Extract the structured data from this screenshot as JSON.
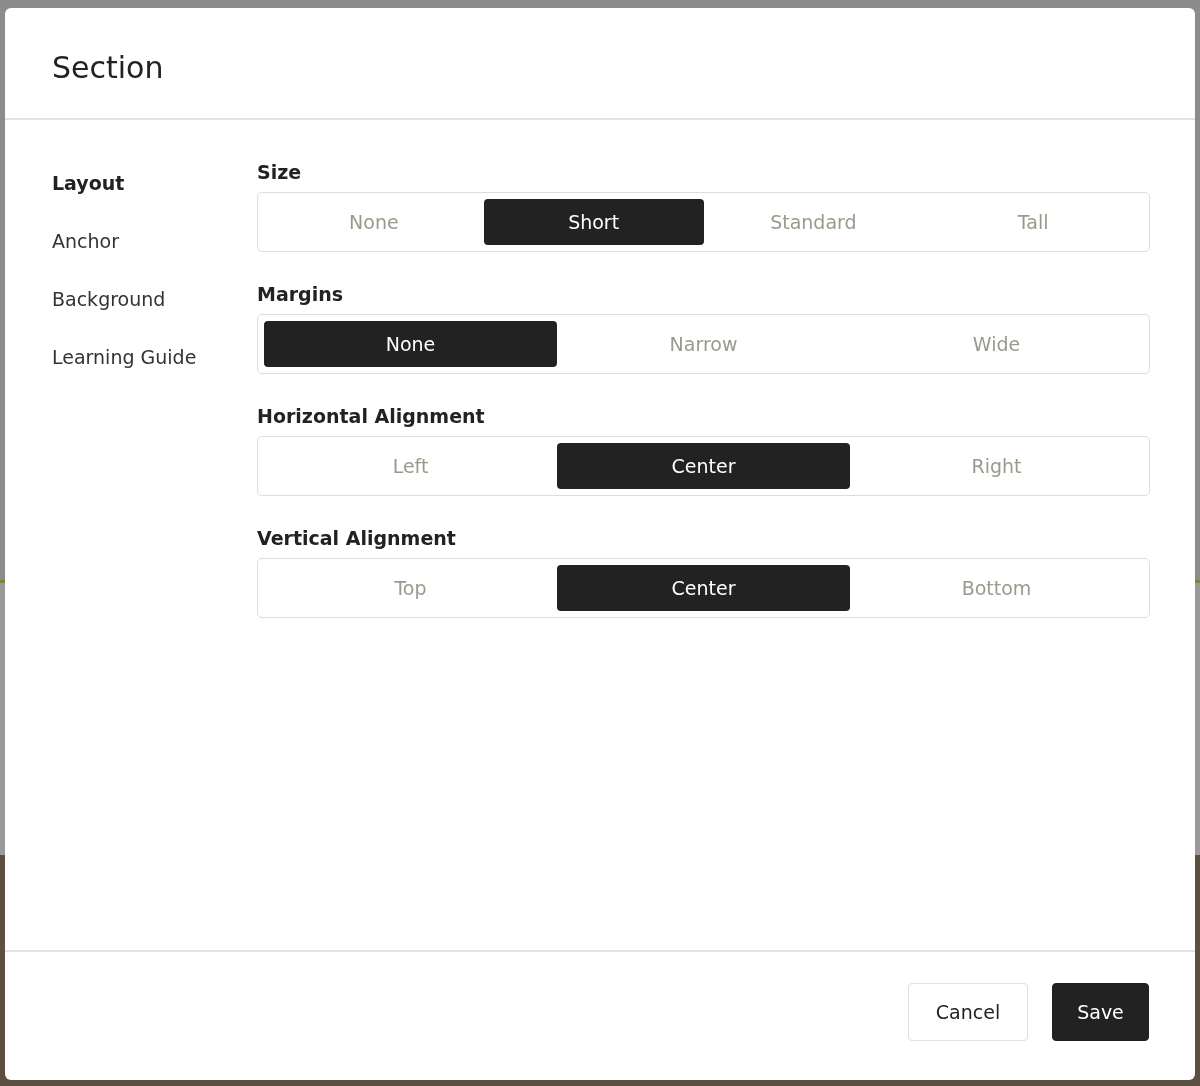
{
  "dialog": {
    "title": "Section",
    "sidebar": {
      "items": [
        {
          "label": "Layout",
          "selected": true
        },
        {
          "label": "Anchor",
          "selected": false
        },
        {
          "label": "Background",
          "selected": false
        },
        {
          "label": "Learning Guide",
          "selected": false
        }
      ]
    },
    "groups": [
      {
        "label": "Size",
        "options": [
          {
            "label": "None",
            "selected": false
          },
          {
            "label": "Short",
            "selected": true
          },
          {
            "label": "Standard",
            "selected": false
          },
          {
            "label": "Tall",
            "selected": false
          }
        ]
      },
      {
        "label": "Margins",
        "options": [
          {
            "label": "None",
            "selected": true
          },
          {
            "label": "Narrow",
            "selected": false
          },
          {
            "label": "Wide",
            "selected": false
          }
        ]
      },
      {
        "label": "Horizontal Alignment",
        "options": [
          {
            "label": "Left",
            "selected": false
          },
          {
            "label": "Center",
            "selected": true
          },
          {
            "label": "Right",
            "selected": false
          }
        ]
      },
      {
        "label": "Vertical Alignment",
        "options": [
          {
            "label": "Top",
            "selected": false
          },
          {
            "label": "Center",
            "selected": true
          },
          {
            "label": "Bottom",
            "selected": false
          }
        ]
      }
    ],
    "buttons": [
      {
        "label": "Cancel",
        "kind": "secondary"
      },
      {
        "label": "Save",
        "kind": "primary"
      }
    ]
  }
}
